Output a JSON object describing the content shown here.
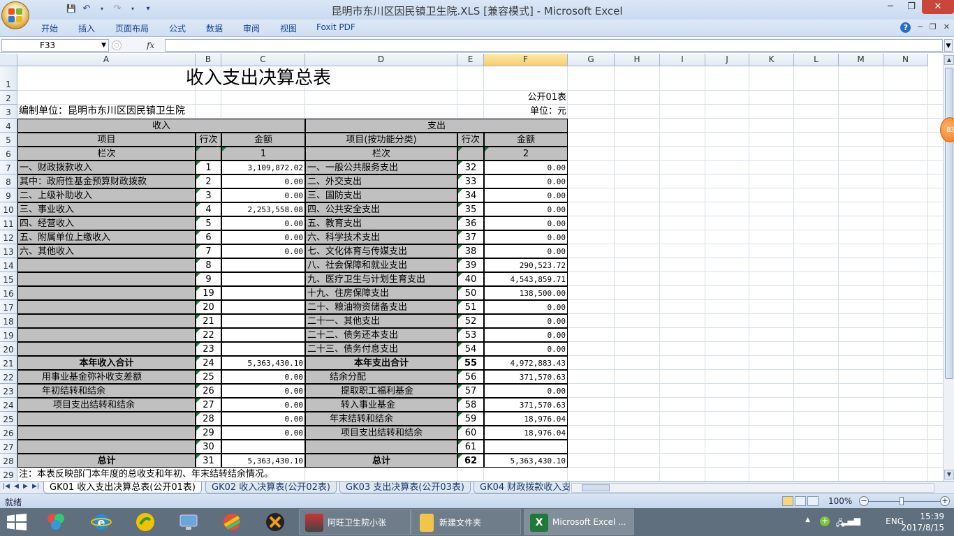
{
  "window": {
    "title": "昆明市东川区因民镇卫生院.XLS  [兼容模式] - Microsoft Excel",
    "minimize": "─",
    "restore": "❐",
    "close": "✕"
  },
  "qat": {
    "save": "💾",
    "undo": "↶",
    "redo": "↷",
    "more": "▾"
  },
  "ribbon": {
    "tabs": [
      "开始",
      "插入",
      "页面布局",
      "公式",
      "数据",
      "审阅",
      "视图",
      "Foxit PDF"
    ],
    "help": "?",
    "min": "─",
    "restore": "❐",
    "close": "✕"
  },
  "formula_bar": {
    "name_box": "F33",
    "fx": "fx",
    "formula": ""
  },
  "columns": [
    "A",
    "B",
    "C",
    "D",
    "E",
    "F",
    "G",
    "H",
    "I",
    "J",
    "K",
    "L",
    "M",
    "N"
  ],
  "selected_column": "F",
  "rows": [
    "1",
    "2",
    "3",
    "4",
    "5",
    "6",
    "7",
    "8",
    "9",
    "10",
    "11",
    "12",
    "13",
    "14",
    "15",
    "16",
    "17",
    "18",
    "19",
    "20",
    "21",
    "22",
    "23",
    "24",
    "25",
    "26",
    "27",
    "28",
    "29"
  ],
  "sheet": {
    "title": "收入支出决算总表",
    "form_no": "公开01表",
    "org": "编制单位：昆明市东川区因民镇卫生院",
    "unit": "单位：元",
    "income_header": "收入",
    "expense_header": "支出",
    "h_item": "项目",
    "h_line": "行次",
    "h_amount": "金额",
    "h_item_func": "项目(按功能分类)",
    "h_line2": "行次",
    "h_amount2": "金额",
    "lanci": "栏次",
    "col1": "1",
    "lanci2": "栏次",
    "col2": "2",
    "note": "注：本表反映部门本年度的总收支和年初、年末结转结余情况。",
    "body": [
      {
        "a": "一、财政拨款收入",
        "b": "1",
        "c": "3,109,872.02",
        "d": "一、一般公共服务支出",
        "e": "32",
        "f": "0.00"
      },
      {
        "a": "    其中：政府性基金预算财政拨款",
        "b": "2",
        "c": "0.00",
        "d": "二、外交支出",
        "e": "33",
        "f": "0.00"
      },
      {
        "a": "二、上级补助收入",
        "b": "3",
        "c": "0.00",
        "d": "三、国防支出",
        "e": "34",
        "f": "0.00"
      },
      {
        "a": "三、事业收入",
        "b": "4",
        "c": "2,253,558.08",
        "d": "四、公共安全支出",
        "e": "35",
        "f": "0.00"
      },
      {
        "a": "四、经营收入",
        "b": "5",
        "c": "0.00",
        "d": "五、教育支出",
        "e": "36",
        "f": "0.00"
      },
      {
        "a": "五、附属单位上缴收入",
        "b": "6",
        "c": "0.00",
        "d": "六、科学技术支出",
        "e": "37",
        "f": "0.00"
      },
      {
        "a": "六、其他收入",
        "b": "7",
        "c": "0.00",
        "d": "七、文化体育与传媒支出",
        "e": "38",
        "f": "0.00"
      },
      {
        "a": "",
        "b": "8",
        "c": "",
        "d": "八、社会保障和就业支出",
        "e": "39",
        "f": "290,523.72"
      },
      {
        "a": "",
        "b": "9",
        "c": "",
        "d": "九、医疗卫生与计划生育支出",
        "e": "40",
        "f": "4,543,859.71"
      },
      {
        "a": "",
        "b": "19",
        "c": "",
        "d": "十九、住房保障支出",
        "e": "50",
        "f": "138,500.00"
      },
      {
        "a": "",
        "b": "20",
        "c": "",
        "d": "二十、粮油物资储备支出",
        "e": "51",
        "f": "0.00"
      },
      {
        "a": "",
        "b": "21",
        "c": "",
        "d": "二十一、其他支出",
        "e": "52",
        "f": "0.00"
      },
      {
        "a": "",
        "b": "22",
        "c": "",
        "d": "二十二、债务还本支出",
        "e": "53",
        "f": "0.00"
      },
      {
        "a": "",
        "b": "23",
        "c": "",
        "d": "二十三、债务付息支出",
        "e": "54",
        "f": "0.00"
      },
      {
        "a": "本年收入合计",
        "b": "24",
        "c": "5,363,430.10",
        "d": "本年支出合计",
        "e": "55",
        "f": "4,972,883.43",
        "bold": true
      },
      {
        "a": "用事业基金弥补收支差额",
        "b": "25",
        "c": "0.00",
        "d": "结余分配",
        "e": "56",
        "f": "371,570.63",
        "ai": 2,
        "di": 2
      },
      {
        "a": "年初结转和结余",
        "b": "26",
        "c": "0.00",
        "d": "提取职工福利基金",
        "e": "57",
        "f": "0.00",
        "ai": 2,
        "di": 3
      },
      {
        "a": "项目支出结转和结余",
        "b": "27",
        "c": "0.00",
        "d": "转入事业基金",
        "e": "58",
        "f": "371,570.63",
        "ai": 3,
        "di": 3
      },
      {
        "a": "",
        "b": "28",
        "c": "0.00",
        "d": "年末结转和结余",
        "e": "59",
        "f": "18,976.04",
        "di": 2
      },
      {
        "a": "",
        "b": "29",
        "c": "0.00",
        "d": "项目支出结转和结余",
        "e": "60",
        "f": "18,976.04",
        "di": 3
      },
      {
        "a": "",
        "b": "30",
        "c": "",
        "d": "",
        "e": "61",
        "f": ""
      },
      {
        "a": "总计",
        "b": "31",
        "c": "5,363,430.10",
        "d": "总计",
        "e": "62",
        "f": "5,363,430.10",
        "bold": true
      }
    ]
  },
  "sheet_tabs": [
    "GK01 收入支出决算总表(公开01表)",
    "GK02 收入决算表(公开02表)",
    "GK03 支出决算表(公开03表)",
    "GK04 财政拨款收入支"
  ],
  "status": {
    "ready": "就绪",
    "zoom": "100%"
  },
  "badge": "83",
  "taskbar": {
    "tasks": [
      "阿旺卫生院小张",
      "新建文件夹",
      "Microsoft Excel ..."
    ],
    "lang": "ENG",
    "time": "15:39",
    "date": "2017/8/15"
  },
  "colors": {
    "gray_fill": "#c0c0c0",
    "green_marker": "#1a7a3a",
    "selected_header": "#f8cd70"
  }
}
